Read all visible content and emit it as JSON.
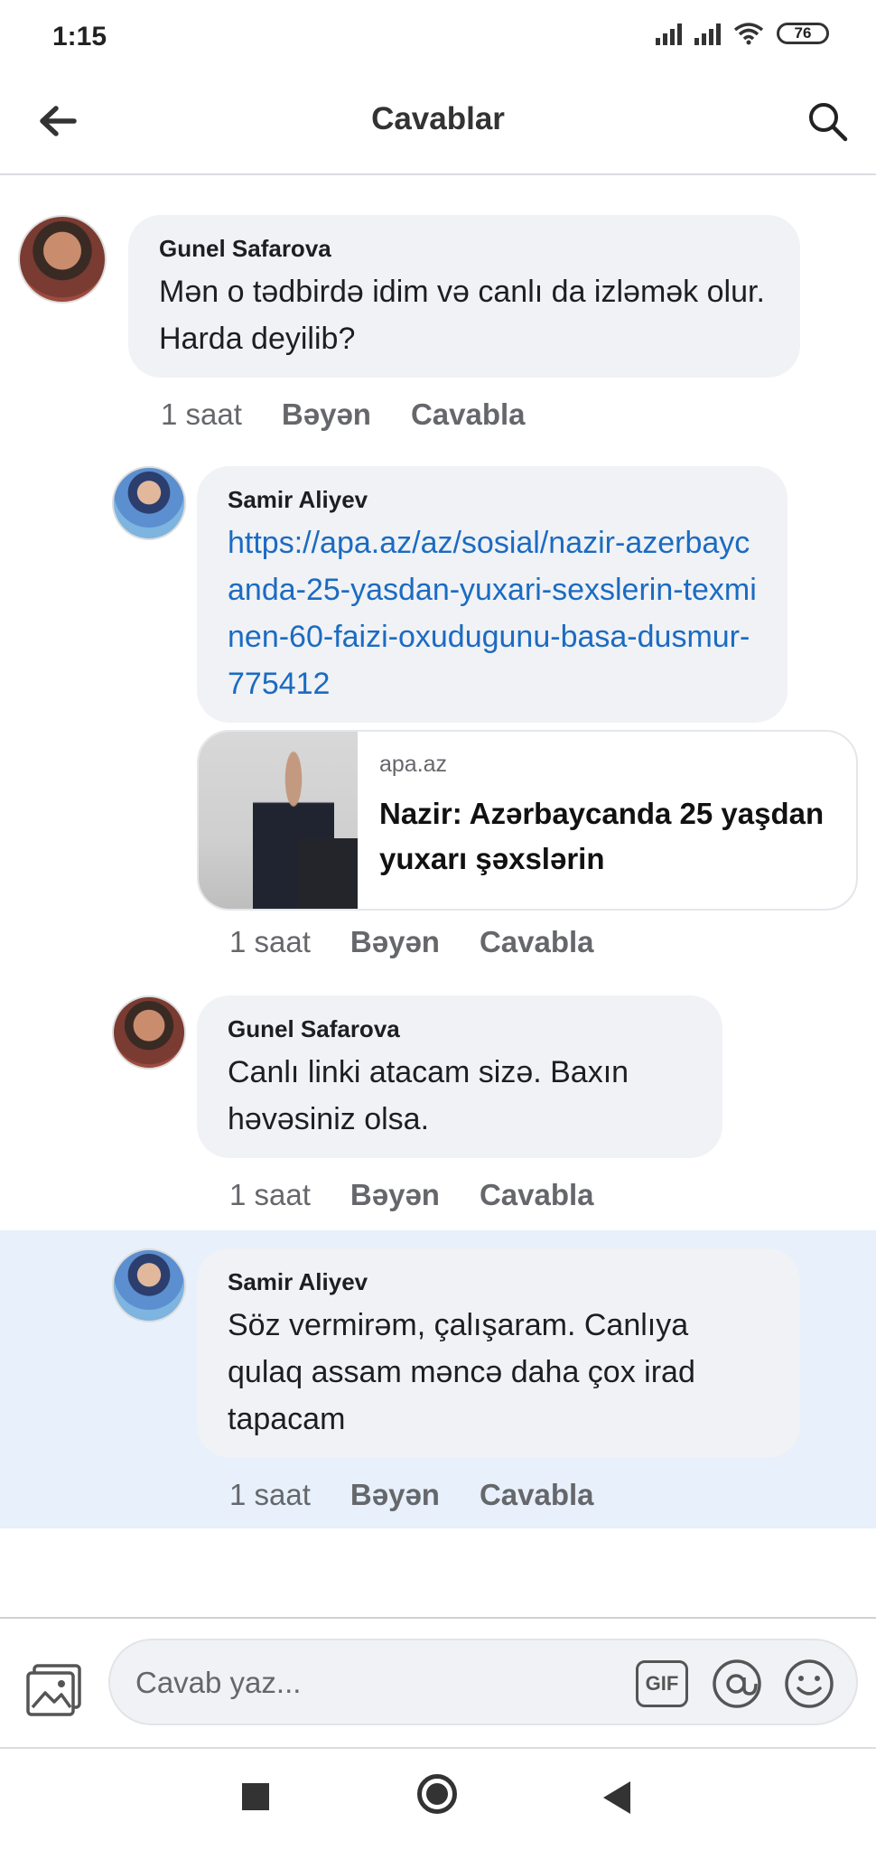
{
  "status_bar": {
    "time": "1:15",
    "battery": "76"
  },
  "header": {
    "title": "Cavablar"
  },
  "comments": [
    {
      "author": "Gunel Safarova",
      "text": "Mən o tədbirdə idim və canlı da izləmək olur. Harda deyilib?",
      "time": "1 saat",
      "like": "Bəyən",
      "reply": "Cavabla"
    },
    {
      "author": "Samir Aliyev",
      "text": "https://apa.az/az/sosial/nazir-azerbaycanda-25-yasdan-yuxari-sexslerin-texminen-60-faizi-oxudugunu-basa-dusmur-775412",
      "time": "1 saat",
      "like": "Bəyən",
      "reply": "Cavabla",
      "link_preview": {
        "domain": "apa.az",
        "title": "Nazir: Azərbaycanda 25 yaşdan yuxarı şəxslərin"
      }
    },
    {
      "author": "Gunel Safarova",
      "text": "Canlı linki atacam sizə. Baxın həvəsiniz olsa.",
      "time": "1 saat",
      "like": "Bəyən",
      "reply": "Cavabla"
    },
    {
      "author": "Samir Aliyev",
      "text": "Söz vermirəm, çalışaram. Canlıya qulaq assam məncə daha çox irad tapacam",
      "time": "1 saat",
      "like": "Bəyən",
      "reply": "Cavabla"
    }
  ],
  "composer": {
    "placeholder": "Cavab yaz...",
    "gif_label": "GIF",
    "icons": [
      "image-icon",
      "gif-icon",
      "mention-icon",
      "emoji-icon"
    ]
  },
  "colors": {
    "link": "#1b6bc2",
    "bubble": "#f0f2f5",
    "highlight": "#e7f0fb"
  }
}
